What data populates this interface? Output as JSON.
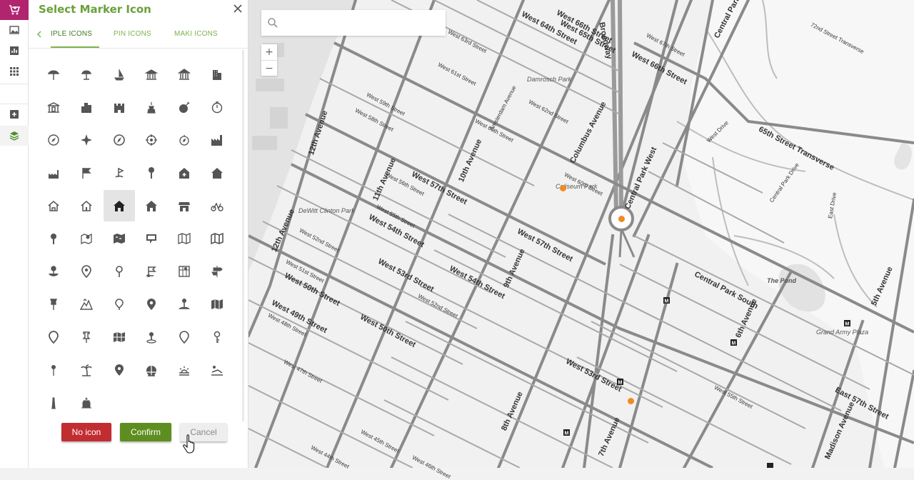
{
  "panel": {
    "title": "Select Marker Icon",
    "tabs": [
      {
        "label": "SIMPLE ICONS",
        "visible_text": "IPLE ICONS",
        "active": true
      },
      {
        "label": "PIN ICONS",
        "active": false
      },
      {
        "label": "MAKI ICONS",
        "active": false
      }
    ],
    "icons": [
      "beach-umbrella-icon",
      "parasol-icon",
      "sailboat-icon",
      "bank-icon",
      "museum-icon",
      "office-building-icon",
      "temple-icon",
      "city-buildings-icon",
      "castle-icon",
      "fountain-icon",
      "bomb-icon",
      "stopwatch-icon",
      "compass-icon",
      "star-compass-icon",
      "compass-needle-icon",
      "crosshair-icon",
      "compass-rose-icon",
      "factory-icon",
      "factory-small-icon",
      "flag-icon",
      "golf-flag-icon",
      "signpost-icon",
      "house-clinic-icon",
      "house-icon",
      "home-outline-icon",
      "home-outline-2-icon",
      "home-selected-icon",
      "home-filled-icon",
      "shop-icon",
      "cycling-route-icon",
      "map-pin-icon",
      "map-fold-pin-icon",
      "world-map-icon",
      "speech-bubble-icon",
      "map-outline-icon",
      "map-open-icon",
      "anchor-pin-icon",
      "location-pin-icon",
      "pin-small-icon",
      "flag-pin-icon",
      "city-map-icon",
      "direction-sign-icon",
      "push-pin-icon",
      "mountain-icon",
      "marker-outline-icon",
      "marker-filled-icon",
      "person-pin-icon",
      "map-folded-icon",
      "location-outline-icon",
      "pushpin-alt-icon",
      "map-grid-icon",
      "pin-on-base-icon",
      "pin-outline-icon",
      "key-pin-icon",
      "needle-pin-icon",
      "palm-tree-icon",
      "pin-solid-icon",
      "globe-icon",
      "sunrise-icon",
      "sunbed-icon",
      "tower-icon",
      "monument-icon"
    ],
    "selected_icon_index": 26
  },
  "buttons": {
    "no_icon": "No icon",
    "confirm": "Confirm",
    "cancel": "Cancel"
  },
  "search": {
    "placeholder": "",
    "value": ""
  },
  "zoom": {
    "in": "+",
    "out": "−"
  },
  "map_labels": [
    "West 64th Street",
    "West 66th Street",
    "West 65th Street",
    "Broadway",
    "West 66th Street",
    "West 67th Street",
    "Central Park West",
    "West 63rd Street",
    "West 62nd Street",
    "West 61st Street",
    "Damrosch Park",
    "Amsterdam Avenue",
    "West 60th Street",
    "West 59th Street",
    "West 58th Street",
    "12th Avenue",
    "West 60th Street",
    "10th Avenue",
    "11th Avenue",
    "West 57th Street",
    "Columbus Avenue",
    "West 56th Street",
    "West 55th Street",
    "Coliseum Park",
    "West 54th Street",
    "DeWitt Clinton Park",
    "West 52nd Street",
    "12th Avenue",
    "West 57th Street",
    "Central Park West",
    "West 51st Street",
    "West 50th Street",
    "West 53rd Street",
    "9th Avenue",
    "West 54th Street",
    "Central Park South",
    "The Pond",
    "West 49th Street",
    "West 48th Street",
    "West 47th Street",
    "West 50th Street",
    "West 53rd Street",
    "Grand Army Plaza",
    "8th Avenue",
    "7th Avenue",
    "6th Avenue",
    "5th Avenue",
    "East 57th Street",
    "Madison Avenue",
    "65th Street Transverse",
    "West Drive",
    "East Drive",
    "Central Park Drive",
    "72nd Street Transverse",
    "West 46th Street",
    "West 44th Street",
    "West 45th Street",
    "West 52nd Street",
    "West 55th Street"
  ],
  "colors": {
    "brand": "#b1256f",
    "title_green": "#6aa03a",
    "confirm_green": "#5e8e1f",
    "no_icon_red": "#c22d32",
    "marker_orange": "#f08a24"
  }
}
